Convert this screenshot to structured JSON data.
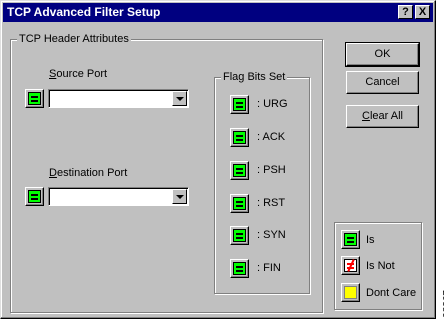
{
  "window": {
    "title": "TCP Advanced Filter Setup",
    "help_glyph": "?",
    "close_glyph": "X"
  },
  "header_group": {
    "label": "TCP Header Attributes",
    "source_port": {
      "label_first": "S",
      "label_rest": "ource Port",
      "value": ""
    },
    "destination_port": {
      "label_first": "D",
      "label_rest": "estination Port",
      "value": ""
    }
  },
  "flag_group": {
    "label": "Flag Bits Set",
    "flags": [
      {
        "label": ":  URG"
      },
      {
        "label": ":  ACK"
      },
      {
        "label": ":  PSH"
      },
      {
        "label": ":  RST"
      },
      {
        "label": ":  SYN"
      },
      {
        "label": ":  FIN"
      }
    ]
  },
  "buttons": {
    "ok": "OK",
    "cancel": "Cancel",
    "clear_all_first": "C",
    "clear_all_rest": "lear All"
  },
  "legend": {
    "is": "Is",
    "is_not": "Is Not",
    "dont_care": "Dont Care"
  },
  "figure_code": "98367",
  "colors": {
    "titlebar": "#000080",
    "face": "#c0c0c0",
    "is_green": "#00ff00",
    "is_not_red": "#ff0000",
    "dont_care_yellow": "#ffff00"
  }
}
